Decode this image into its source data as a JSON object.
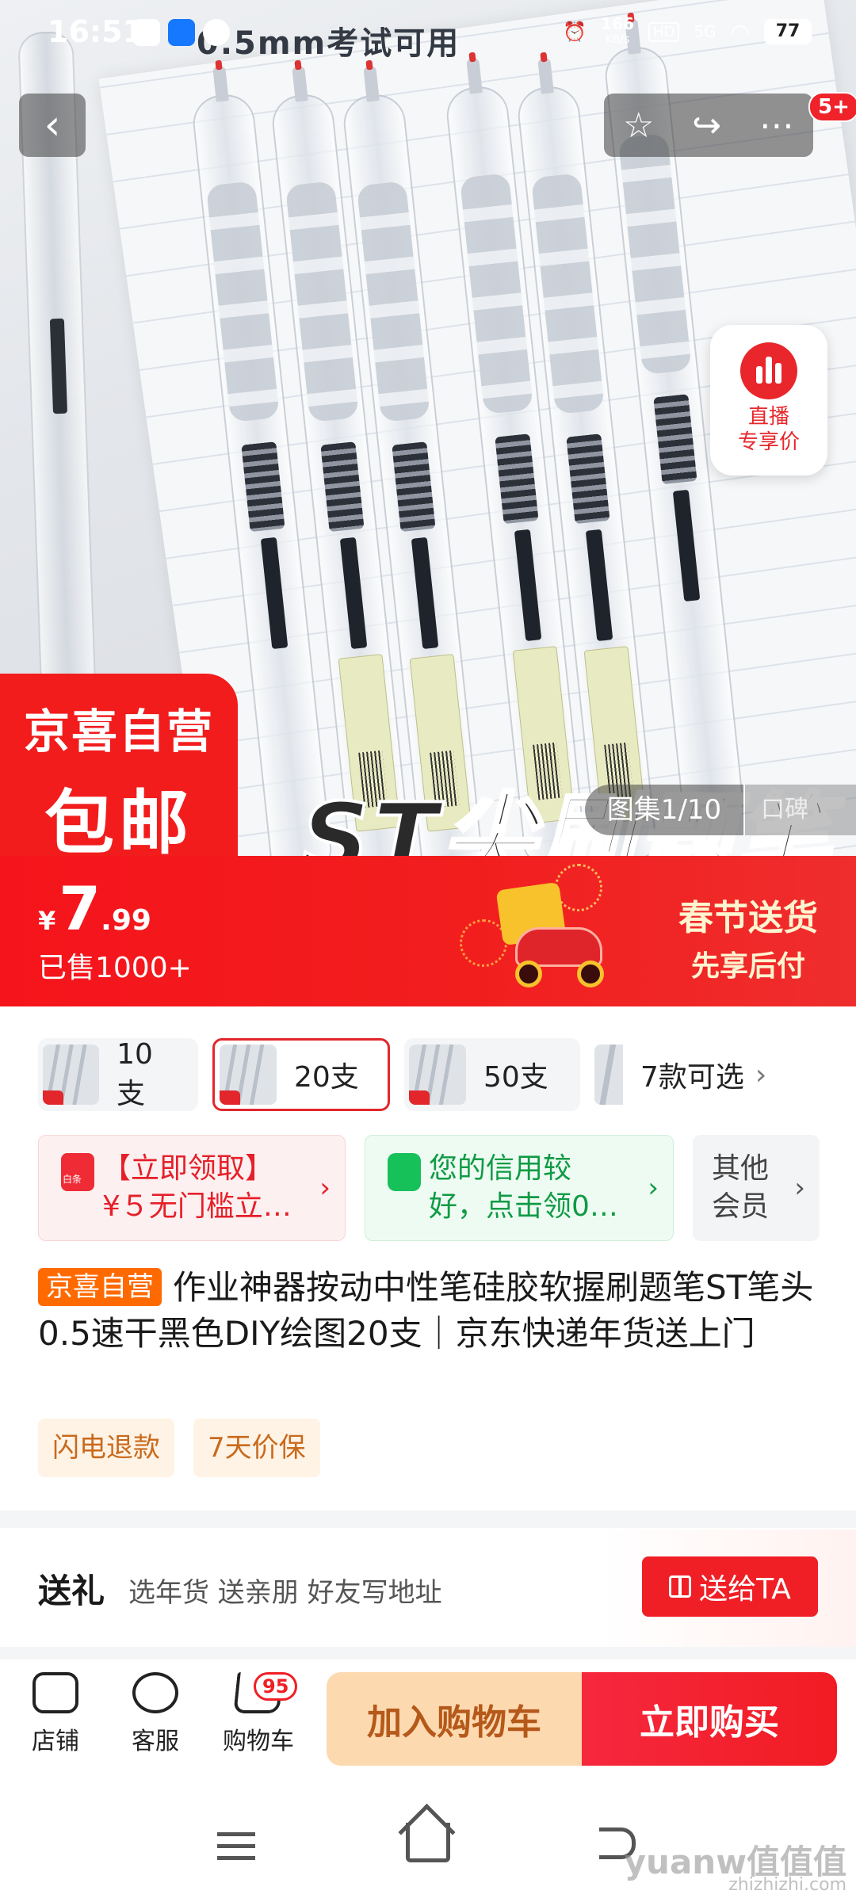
{
  "status_bar": {
    "time": "16:51",
    "net_speed_value": "166",
    "net_speed_unit": "KB/s",
    "hd": "HD",
    "signal": "5G",
    "battery": "77"
  },
  "hero": {
    "overlay_top_text": "0.5mm考试可用",
    "overlay_bottom_text": "ST尖刷题笔",
    "promo_badge": {
      "line1": "京喜自营",
      "line2": "包邮"
    },
    "gallery_counter": "图集1/10",
    "review_tab": "口碑",
    "live_card": {
      "line1": "直播",
      "line2": "专享价"
    },
    "notification_badge": "5+"
  },
  "price_banner": {
    "currency": "¥",
    "price_int": "7",
    "price_dec": ".99",
    "sold": "已售1000+",
    "promo_line1": "春节送货",
    "promo_line2": "先享后付"
  },
  "sku": {
    "options": [
      {
        "label": "10支",
        "selected": false
      },
      {
        "label": "20支",
        "selected": true
      },
      {
        "label": "50支",
        "selected": false
      }
    ],
    "more": "7款可选"
  },
  "coupons": {
    "baitiao": "【立即领取】\n¥５无门槛立…",
    "credit": "您的信用较\n好，点击领0…",
    "member": "其他\n会员"
  },
  "product": {
    "self_operated_tag": "京喜自营",
    "title": "作业神器按动中性笔硅胶软握刷题笔ST笔头0.5速干黑色DIY绘图20支｜京东快递年货送上门",
    "service_tags": [
      "闪电退款",
      "7天价保"
    ]
  },
  "gift": {
    "title": "送礼",
    "subtitle": "选年货 送亲朋 好友写地址",
    "button": "送给TA"
  },
  "bottom_bar": {
    "store": "店铺",
    "service": "客服",
    "cart": "购物车",
    "cart_count": "95",
    "add_to_cart": "加入购物车",
    "buy_now": "立即购买"
  },
  "watermark": {
    "main": "yuanw值值值",
    "sub": "zhizhizhi.com"
  }
}
